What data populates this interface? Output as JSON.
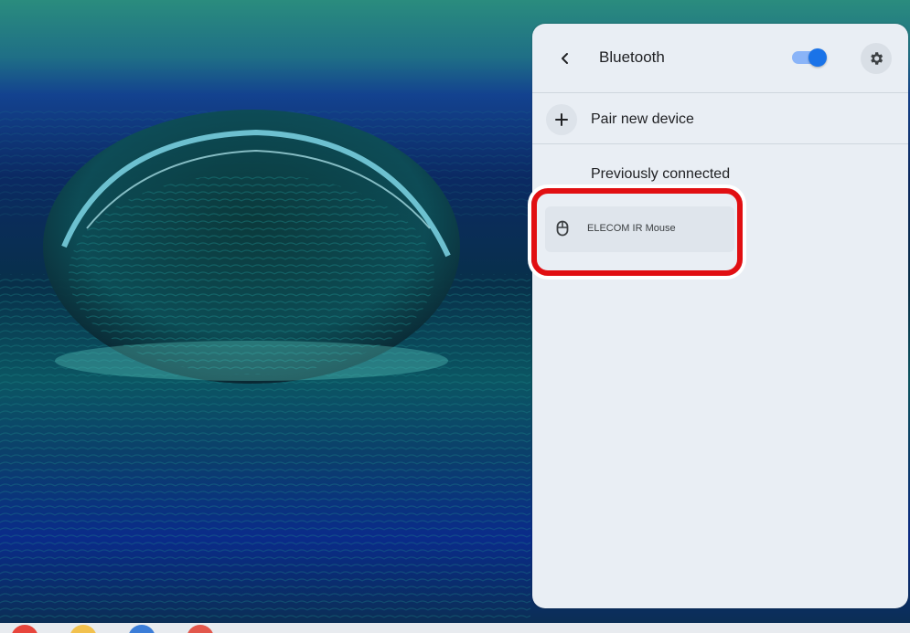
{
  "bluetooth_panel": {
    "title": "Bluetooth",
    "toggle_on": true,
    "icons": {
      "back": "chevron-left-icon",
      "settings": "gear-icon",
      "pair": "plus-icon",
      "device": "mouse-icon"
    },
    "pair_new_device_label": "Pair new device",
    "previously_connected_heading": "Previously connected",
    "devices": [
      {
        "name": "ELECOM IR Mouse"
      }
    ]
  },
  "colors": {
    "panel_bg": "#e9eef4",
    "toggle_track": "#8ab4f8",
    "toggle_knob": "#1a73e8",
    "highlight": "#e10f12"
  }
}
